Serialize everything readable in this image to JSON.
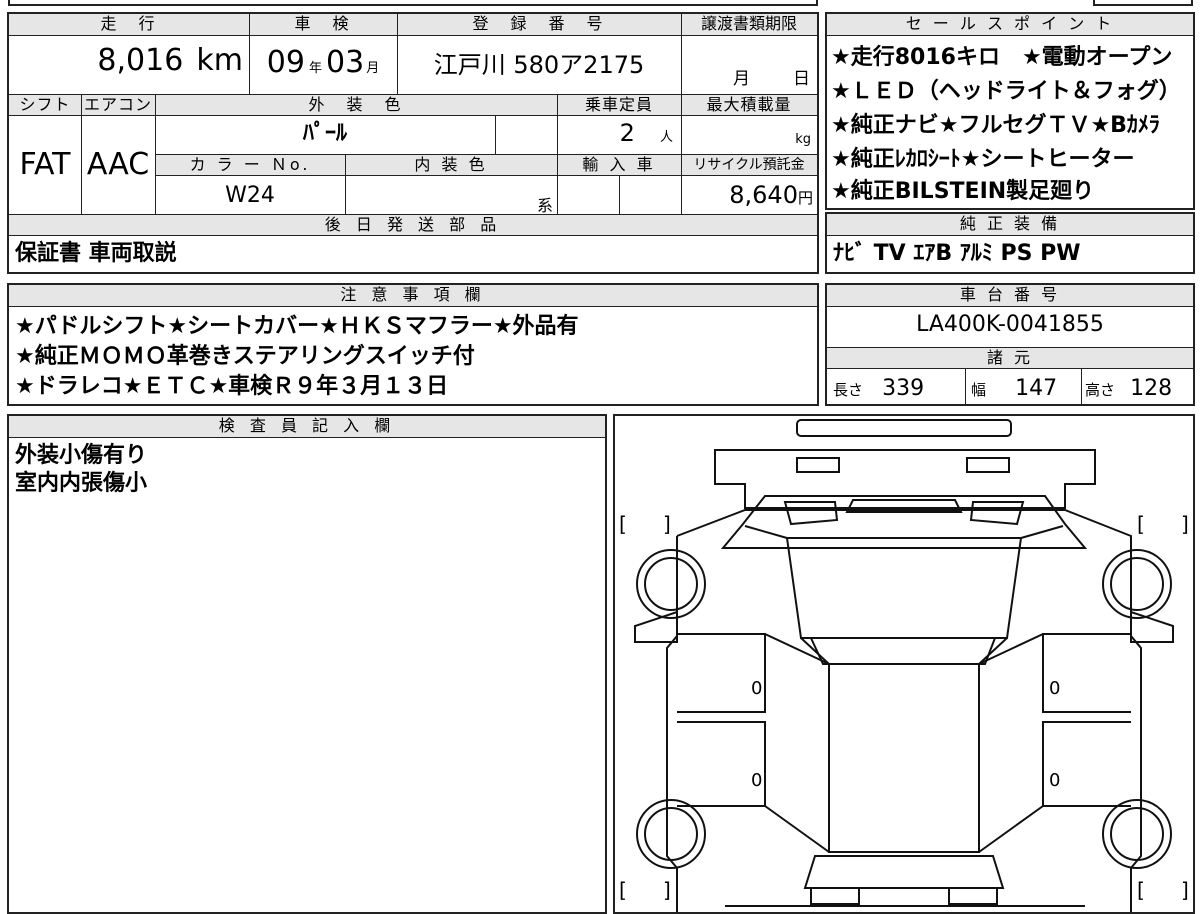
{
  "row1": {
    "mileage_label": "走　行",
    "mileage_value": "8,016",
    "mileage_unit": "km",
    "inspection_label": "車　検",
    "inspection_year": "09",
    "inspection_year_unit": "年",
    "inspection_month": "03",
    "inspection_month_unit": "月",
    "registration_label": "登　録　番　号",
    "registration_value": "江戸川 580ア2175",
    "transfer_label": "譲渡書類期限",
    "transfer_month_unit": "月",
    "transfer_day_unit": "日"
  },
  "row2": {
    "shift_label": "シフト",
    "shift_value": "FAT",
    "aircon_label": "エアコン",
    "aircon_value": "AAC",
    "exterior_label": "外　装　色",
    "exterior_value": "ﾊﾟｰﾙ",
    "capacity_label": "乗車定員",
    "capacity_value": "2",
    "capacity_unit": "人",
    "load_label": "最大積載量",
    "load_unit": "kg",
    "color_no_label": "カ ラ ー Ｎo.",
    "color_no_value": "W24",
    "interior_label": "内 装 色",
    "interior_unit": "系",
    "import_label": "輸 入 車",
    "recycle_label": "リサイクル預託金",
    "recycle_value": "8,640",
    "recycle_unit": "円"
  },
  "parts": {
    "label": "後 日 発 送 部 品",
    "value": "保証書 車両取説"
  },
  "sales": {
    "label": "セ ー ル ス ポ イ ン ト",
    "lines": [
      "★走行8016キロ　★電動オープン",
      "★ＬＥＤ（ヘッドライト＆フォグ）",
      "★純正ナビ★フルセグＴＶ★Bｶﾒﾗ",
      "★純正ﾚｶﾛｼｰﾄ★シートヒーター",
      "★純正BILSTEIN製足廻り"
    ]
  },
  "equipment": {
    "label": "純 正 装 備",
    "value": "ﾅﾋﾞ TV ｴｱB ｱﾙﾐ PS PW"
  },
  "notes": {
    "label": "注 意 事 項 欄",
    "lines": [
      "★パドルシフト★シートカバー★ＨＫＳマフラー★外品有",
      "★純正ＭＯＭＯ革巻きステアリングスイッチ付",
      "★ドラレコ★ＥＴＣ★車検Ｒ９年３月１３日"
    ]
  },
  "chassis": {
    "label": "車 台 番 号",
    "value": "LA400K-0041855"
  },
  "specs": {
    "label": "諸 元",
    "length_label": "長さ",
    "length_value": "339",
    "width_label": "幅",
    "width_value": "147",
    "height_label": "高さ",
    "height_value": "128"
  },
  "inspector": {
    "label": "検 査 員 記 入 欄",
    "lines": [
      "外装小傷有り",
      "室内内張傷小"
    ]
  },
  "diagram": {
    "panel_marks": [
      "0",
      "0",
      "0",
      "0"
    ],
    "bracket_open": "[",
    "bracket_close": "]"
  }
}
